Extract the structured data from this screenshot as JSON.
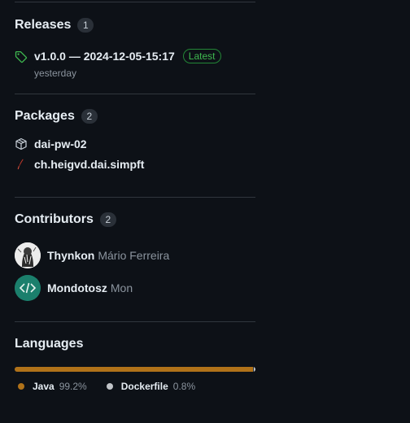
{
  "releases": {
    "title": "Releases",
    "count": "1",
    "latest": {
      "name": "v1.0.0 — 2024-12-05-15:17",
      "badge": "Latest",
      "date": "yesterday"
    }
  },
  "packages": {
    "title": "Packages",
    "count": "2",
    "items": [
      {
        "name": "dai-pw-02",
        "icon": "package-icon"
      },
      {
        "name": "ch.heigvd.dai.simpft",
        "icon": "maven-feather-icon"
      }
    ]
  },
  "contributors": {
    "title": "Contributors",
    "count": "2",
    "items": [
      {
        "login": "Thynkon",
        "full_name": "Mário Ferreira",
        "avatar": "avatar-thynkon"
      },
      {
        "login": "Mondotosz",
        "full_name": "Mon",
        "avatar": "avatar-mondotosz-code-icon"
      }
    ]
  },
  "languages": {
    "title": "Languages",
    "items": [
      {
        "name": "Java",
        "percent_label": "99.2%",
        "percent": 99.2,
        "color": "#b07219"
      },
      {
        "name": "Dockerfile",
        "percent_label": "0.8%",
        "percent": 0.8,
        "color": "#c0c4c8"
      }
    ]
  },
  "colors": {
    "background": "#0d1117",
    "divider": "#30363d",
    "latest_badge": "#3fb950"
  }
}
